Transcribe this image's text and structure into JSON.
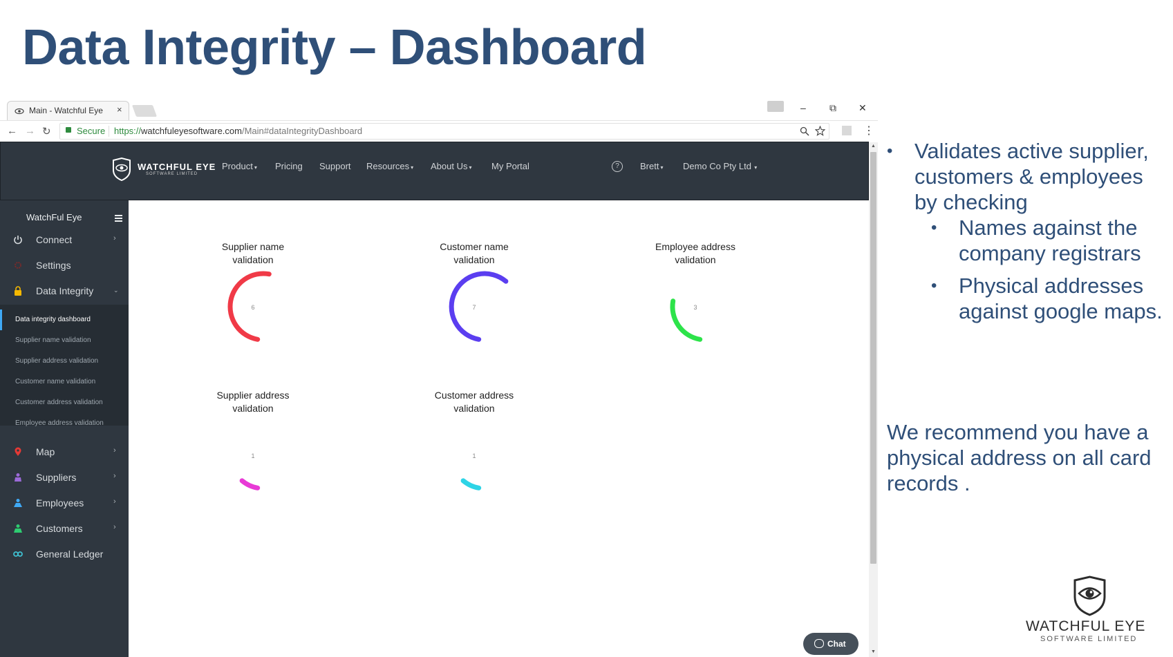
{
  "slide": {
    "title": "Data Integrity – Dashboard",
    "bullets": {
      "main": "Validates active supplier, customers & employees by checking",
      "sub": [
        "Names against the company registrars",
        "Physical addresses against google maps."
      ]
    },
    "recommendation": "We recommend you have a physical address on all card records .",
    "logo": {
      "name": "WATCHFUL EYE",
      "sub": "SOFTWARE LIMITED"
    }
  },
  "browser": {
    "tab_title": "Main - Watchful Eye",
    "tab_close": "×",
    "secure_label": "Secure",
    "url_scheme": "https://",
    "url_host": "watchfuleyesoftware.com",
    "url_path": "/Main#dataIntegrityDashboard",
    "controls": {
      "minimize": "–",
      "restore": "⧉",
      "close": "✕"
    },
    "nav": {
      "back": "←",
      "forward": "→",
      "reload": "↻"
    }
  },
  "topnav": {
    "brand_name": "WATCHFUL EYE",
    "brand_sub": "SOFTWARE LIMITED",
    "items": [
      "Product",
      "Pricing",
      "Support",
      "Resources",
      "About Us",
      "My Portal"
    ],
    "help": "?",
    "user": "Brett",
    "company": "Demo Co Pty Ltd"
  },
  "sidebar": {
    "title": "WatchFul Eye",
    "items": [
      "Connect",
      "Settings",
      "Data Integrity",
      "Map",
      "Suppliers",
      "Employees",
      "Customers",
      "General Ledger"
    ],
    "sub_items": [
      "Data integrity dashboard",
      "Supplier name validation",
      "Supplier address validation",
      "Customer name validation",
      "Customer address validation",
      "Employee address validation"
    ],
    "icon_colors": {
      "Connect": "#d7dbde",
      "Settings": "#e53935",
      "Data Integrity": "#f5b800",
      "Map": "#e53935",
      "Suppliers": "#9c6ad8",
      "Employees": "#3fa9f5",
      "Customers": "#2ecc71",
      "General Ledger": "#3fbfd0"
    }
  },
  "gauges": [
    {
      "label_line1": "Supplier name",
      "label_line2": "validation",
      "value": 6,
      "color": "#f03a47"
    },
    {
      "label_line1": "Customer name",
      "label_line2": "validation",
      "value": 7,
      "color": "#5b3ef0"
    },
    {
      "label_line1": "Employee address",
      "label_line2": "validation",
      "value": 3,
      "color": "#2de34a"
    },
    {
      "label_line1": "Supplier address",
      "label_line2": "validation",
      "value": 1,
      "color": "#e83ad6"
    },
    {
      "label_line1": "Customer address",
      "label_line2": "validation",
      "value": 1,
      "color": "#2ed4e6"
    }
  ],
  "chat_label": "Chat"
}
